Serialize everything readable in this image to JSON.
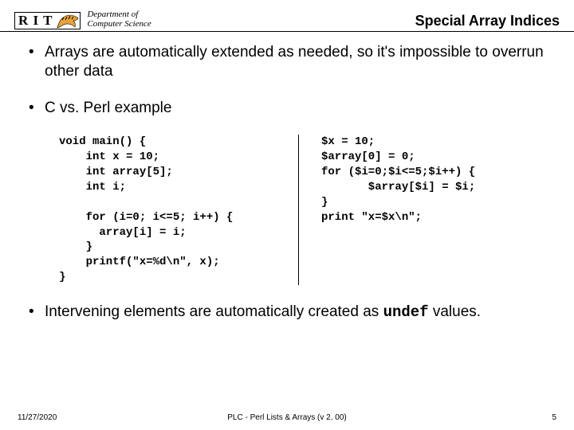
{
  "header": {
    "rit_letters": "R I T",
    "dept_line1": "Department of",
    "dept_line2": "Computer Science",
    "slide_title": "Special Array Indices"
  },
  "bullets": {
    "b1": "Arrays are automatically extended as needed, so it's impossible to overrun other data",
    "b2": "C vs. Perl example",
    "b3_part1": "Intervening elements are automatically created as ",
    "b3_mono": "undef",
    "b3_part2": " values."
  },
  "code": {
    "c": "void main() {\n    int x = 10;\n    int array[5];\n    int i;\n\n    for (i=0; i<=5; i++) {\n      array[i] = i;\n    }\n    printf(\"x=%d\\n\", x);\n}",
    "perl": "$x = 10;\n$array[0] = 0;\nfor ($i=0;$i<=5;$i++) {\n       $array[$i] = $i;\n}\nprint \"x=$x\\n\";"
  },
  "footer": {
    "left": "11/27/2020",
    "center": "PLC - Perl Lists & Arrays (v 2. 00)",
    "right": "5"
  }
}
